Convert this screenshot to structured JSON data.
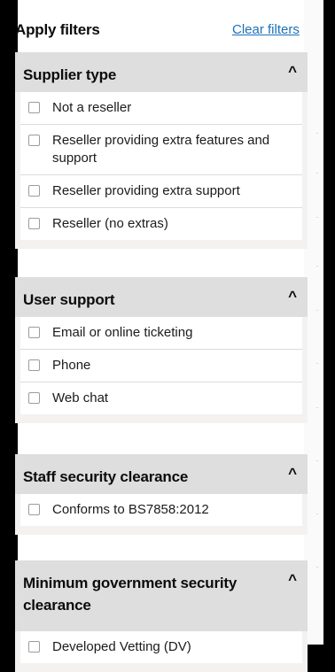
{
  "header": {
    "title": "Apply filters",
    "clear_link": "Clear filters"
  },
  "filters": [
    {
      "title": "Supplier type",
      "toggle": "^",
      "options": [
        "Not a reseller",
        "Reseller providing extra features and support",
        "Reseller providing extra support",
        "Reseller (no extras)"
      ]
    },
    {
      "title": "User support",
      "toggle": "^",
      "options": [
        "Email or online ticketing",
        "Phone",
        "Web chat"
      ]
    },
    {
      "title": "Staff security clearance",
      "toggle": "^",
      "options": [
        "Conforms to BS7858:2012"
      ]
    },
    {
      "title": "Minimum government security clearance",
      "toggle": "^",
      "options": [
        "Developed Vetting (DV)"
      ]
    }
  ]
}
